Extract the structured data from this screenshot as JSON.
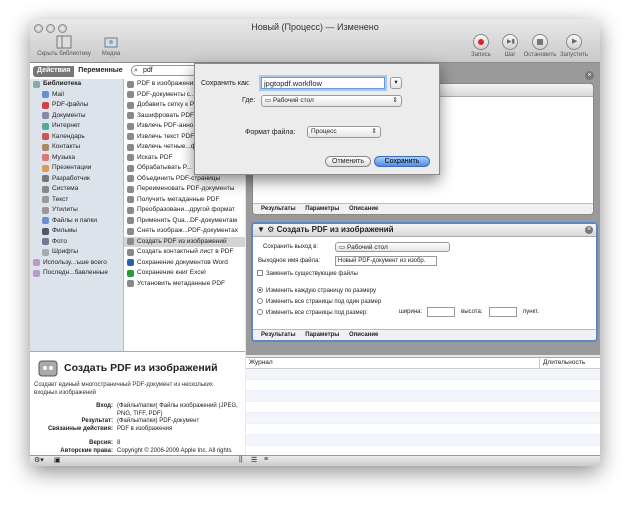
{
  "window": {
    "title": "Новый (Процесс) — Изменено"
  },
  "toolbar": {
    "hide_library": "Скрыть библиотеку",
    "media": "Медиа",
    "record": "Запись",
    "step": "Шаг",
    "stop": "Остановить",
    "run": "Запустить"
  },
  "library": {
    "tab_actions": "Действия",
    "tab_variables": "Переменные",
    "search_value": "pdf",
    "categories": [
      "Библиотека",
      "Mail",
      "PDF-файлы",
      "Документы",
      "Интернет",
      "Календарь",
      "Контакты",
      "Музыка",
      "Презентации",
      "Разработчик",
      "Система",
      "Текст",
      "Утилиты",
      "Файлы и папки",
      "Фильмы",
      "Фото",
      "Шрифты",
      "Использу...ъше всего",
      "Последн...бавленные"
    ],
    "actions": [
      "PDF в изображения",
      "PDF-документы с...",
      "Добавить сетку к PDF",
      "Зашифровать PDF-...",
      "Извлечь PDF-анно...",
      "Извлечь текст PDF",
      "Извлечь четные...ф страницы",
      "Искать PDF",
      "Обрабатывать P...",
      "Объединить PDF-страницы",
      "Переименовать PDF-документы",
      "Получить метаданные PDF",
      "Преобразовани...другой формат",
      "Применить Qua...DF-документам",
      "Снять изображ...PDF-документах",
      "Создать PDF из изображений",
      "Создать контактный лист в PDF",
      "Сохранение документов Word",
      "Сохранение книг Excel",
      "Установить метаданные PDF"
    ],
    "selected_action_index": 15
  },
  "info": {
    "title": "Создать PDF из изображений",
    "description": "Создает единый многостраничный PDF-документ из нескольких входных изображений",
    "input_label": "Вход:",
    "input_value": "(Файлы/папки) Файлы изображений (JPEG, PNG, TIFF, PDF)",
    "result_label": "Результат:",
    "result_value": "(Файлы/папки) PDF-документ",
    "related_label": "Связанные действия:",
    "related_value": "PDF в изображения",
    "version_label": "Версия:",
    "version_value": "8",
    "copyright_label": "Авторские права:",
    "copyright_value": "Copyright © 2006-2009 Apple Inc. All rights reserved."
  },
  "save_sheet": {
    "save_as_label": "Сохранить как:",
    "save_as_value": "jpgtopdf.workflow",
    "where_label": "Где:",
    "where_value": "Рабочий стол",
    "format_label": "Формат файла:",
    "format_value": "Процесс",
    "cancel": "Отменить",
    "save": "Сохранить"
  },
  "action1": {
    "tabs": [
      "Результаты",
      "Параметры",
      "Описание"
    ]
  },
  "action2": {
    "title": "Создать PDF из изображений",
    "save_output_label": "Сохранить выход в:",
    "save_output_value": "Рабочий стол",
    "filename_label": "Выходное имя файла:",
    "filename_value": "Новый PDF-документ из изобр.",
    "replace_label": "Заменить существующие файлы",
    "radio1": "Изменить каждую страницу по размеру",
    "radio2": "Изменить все страницы под один размер",
    "radio3": "Изменить все страницы под размер:",
    "width_label": "ширина:",
    "height_label": "высота:",
    "points_label": "пункт.",
    "tabs": [
      "Результаты",
      "Параметры",
      "Описание"
    ]
  },
  "log": {
    "col_journal": "Журнал",
    "col_duration": "Длительность"
  },
  "colors": {
    "selection_blue": "#5a87c9",
    "record_red": "#d22",
    "save_button": "#4f8fe3"
  }
}
